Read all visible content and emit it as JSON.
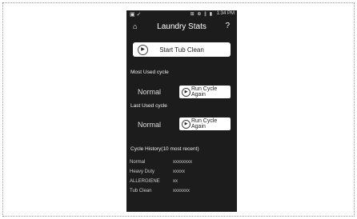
{
  "status": {
    "time": "1:34 PM",
    "signal": "⊞ ⊕ ∥ ▮"
  },
  "header": {
    "title": "Laundry Stats",
    "help": "?"
  },
  "start_tub_label": "Start Tub Clean",
  "most_used": {
    "label": "Most Used cycle",
    "cycle": "Normal",
    "button": "Run Cycle Again"
  },
  "last_used": {
    "label": "Last Used cycle",
    "cycle": "Normal",
    "button": "Run Cycle Again"
  },
  "history": {
    "label": "Cycle History(10 most recent)",
    "rows": [
      {
        "name": "Normal",
        "value": "xxxxxxxx"
      },
      {
        "name": "Heavy Duty",
        "value": "xxxxx"
      },
      {
        "name": "ALLERGIENE",
        "value": "xx"
      },
      {
        "name": "Tub Clean",
        "value": "xxxxxxx"
      }
    ]
  }
}
